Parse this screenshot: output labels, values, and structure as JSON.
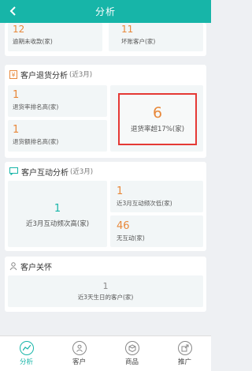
{
  "header": {
    "title": "分析"
  },
  "top": {
    "left": {
      "value": "12",
      "label": "逾期未收款(家)"
    },
    "right": {
      "value": "11",
      "label": "坏账客户(家)"
    }
  },
  "returns": {
    "title": "客户退货分析",
    "period": "(近3月)",
    "tile_rank_count": {
      "value": "1",
      "label": "退货率排名高(家)"
    },
    "tile_rank_amount": {
      "value": "1",
      "label": "退货额排名高(家)"
    },
    "tile_rate": {
      "value": "6",
      "label": "退货率超17%(家)"
    }
  },
  "interaction": {
    "title": "客户互动分析",
    "period": "(近3月)",
    "tile_high": {
      "value": "1",
      "label": "近3月互动频次高(家)"
    },
    "tile_low": {
      "value": "1",
      "label": "近3月互动频次低(家)"
    },
    "tile_none": {
      "value": "46",
      "label": "无互动(家)"
    }
  },
  "care": {
    "title": "客户关怀",
    "tile_birthday": {
      "value": "1",
      "label": "近3天生日的客户(家)"
    }
  },
  "nav": [
    {
      "label": "分析",
      "icon": "analysis-icon",
      "active": true
    },
    {
      "label": "客户",
      "icon": "customer-icon",
      "active": false
    },
    {
      "label": "商品",
      "icon": "product-icon",
      "active": false
    },
    {
      "label": "推广",
      "icon": "promotion-icon",
      "active": false
    }
  ],
  "colors": {
    "accent": "#17b5a8",
    "number": "#e8883a",
    "highlight": "#e53935"
  }
}
